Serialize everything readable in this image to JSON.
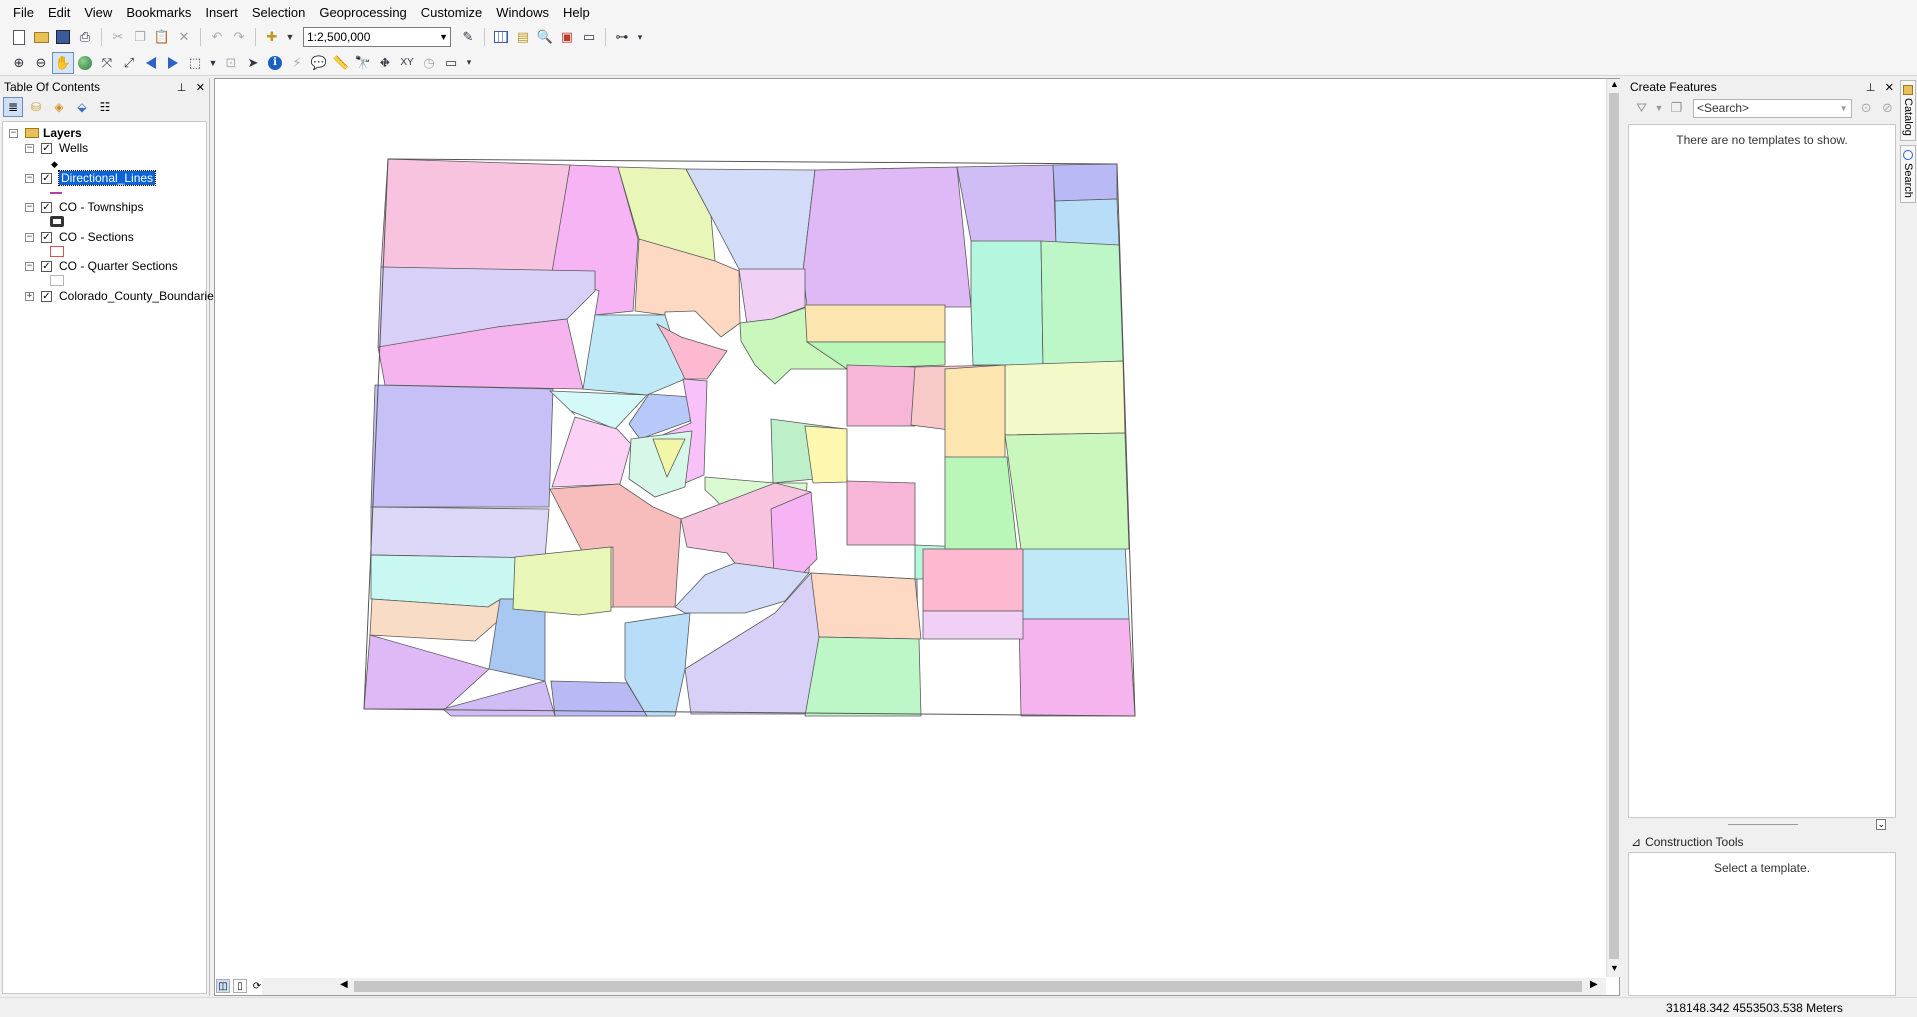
{
  "menu": [
    "File",
    "Edit",
    "View",
    "Bookmarks",
    "Insert",
    "Selection",
    "Geoprocessing",
    "Customize",
    "Windows",
    "Help"
  ],
  "toolbar": {
    "scale": "1:2,500,000"
  },
  "toc": {
    "title": "Table Of Contents",
    "root": "Layers",
    "layers": [
      {
        "name": "Wells",
        "checked": true,
        "expanded": true,
        "symbol": "point"
      },
      {
        "name": "Directional_Lines",
        "checked": true,
        "expanded": true,
        "selected": true,
        "symbol": "line"
      },
      {
        "name": "CO - Townships",
        "checked": true,
        "expanded": true,
        "symbol": "thick-outline"
      },
      {
        "name": "CO - Sections",
        "checked": true,
        "expanded": true,
        "symbol": "red-outline"
      },
      {
        "name": "CO - Quarter Sections",
        "checked": true,
        "expanded": true,
        "symbol": "gray-outline"
      },
      {
        "name": "Colorado_County_Boundaries",
        "checked": true,
        "expanded": false,
        "symbol": "none"
      }
    ]
  },
  "create_features": {
    "title": "Create Features",
    "search_placeholder": "<Search>",
    "empty_message": "There are no templates to show.",
    "construction_title": "Construction Tools",
    "construction_message": "Select a template."
  },
  "side_tabs": [
    "Catalog",
    "Search"
  ],
  "status": {
    "coordinates": "318148.342  4553503.538 Meters"
  },
  "map": {
    "county_colors": [
      "#f7c3df",
      "#f7b4f5",
      "#e8f7b8",
      "#d2dcf8",
      "#dfb8f6",
      "#d0bdf6",
      "#b9b9f6",
      "#b7ddf9",
      "#d9d0f7",
      "#fdd8c3",
      "#b5f6de",
      "#bdf7c8",
      "#bfe9f7",
      "#f6b4ee",
      "#fdb9cf",
      "#f0d0f5",
      "#c9f7bc",
      "#fde5b0",
      "#b8f7b8",
      "#f7b6d8",
      "#f8c9c9",
      "#f3f9c8",
      "#c6c0f7",
      "#d5f9f9",
      "#fbd2f6",
      "#b6c9f8",
      "#f9c1f9",
      "#d7f7e8",
      "#bdefc9",
      "#d9fad0",
      "#fdf7b0",
      "#dcd6f7",
      "#f7bdbd",
      "#f2f7a8",
      "#c9f7f2",
      "#f9dcc6",
      "#a8c8f2",
      "#fce9c8"
    ]
  }
}
